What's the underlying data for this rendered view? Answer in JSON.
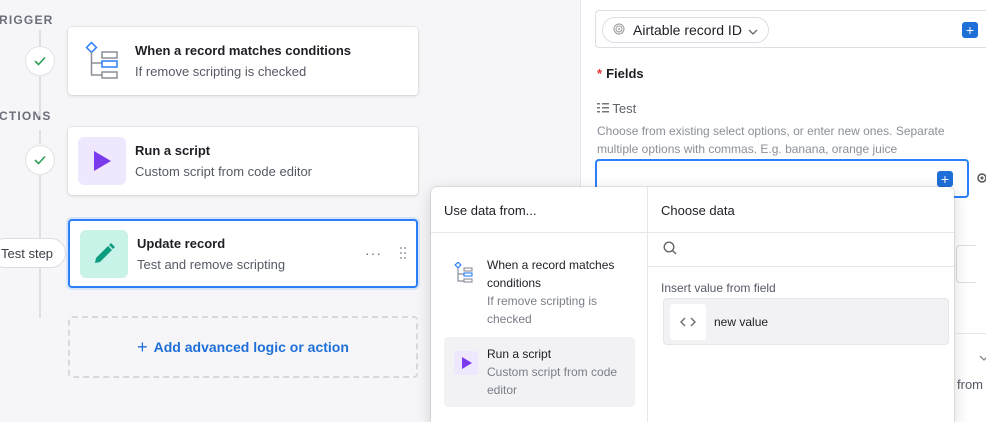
{
  "canvas": {
    "trigger_label": "RIGGER",
    "actions_label": "CTIONS",
    "test_step_label": "Test step",
    "trigger_card": {
      "title": "When a record matches conditions",
      "subtitle": "If remove scripting is checked"
    },
    "script_card": {
      "title": "Run a script",
      "subtitle": "Custom script from code editor"
    },
    "update_card": {
      "title": "Update record",
      "subtitle": "Test and remove scripting",
      "more": "···"
    },
    "add_logic": "Add advanced logic or action"
  },
  "panel": {
    "record_id_pill": "Airtable record ID",
    "fields_required": "*",
    "fields_label": "Fields",
    "field_name": "Test",
    "field_hint": "Choose from existing select options, or enter new ones. Separate multiple options with commas. E.g. banana, orange juice",
    "stub_text": "from"
  },
  "popover": {
    "left_header": "Use data from...",
    "right_header": "Choose data",
    "sources": [
      {
        "title": "When a record matches conditions",
        "subtitle": "If remove scripting is checked"
      },
      {
        "title": "Run a script",
        "subtitle": "Custom script from code editor"
      }
    ],
    "search_placeholder": "",
    "insert_label": "Insert value from field",
    "value_item": "new value"
  },
  "colors": {
    "accent_blue": "#1f6fd8",
    "script_purple": "#7c3aed",
    "update_teal": "#0f9d80"
  }
}
